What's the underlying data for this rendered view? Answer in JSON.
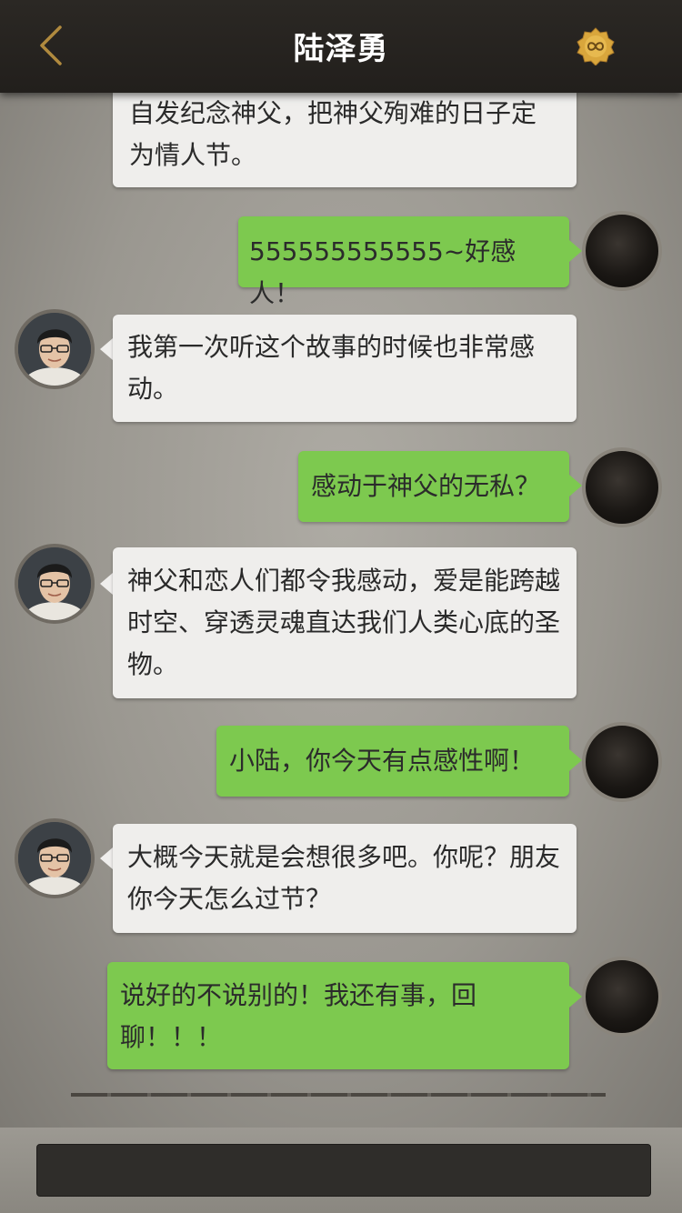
{
  "header": {
    "title": "陆泽勇",
    "back_icon": "chevron-left-icon",
    "badge_icon": "infinity-badge-icon",
    "accent": "#c89a3a"
  },
  "messages": [
    {
      "sender": "other",
      "text": "自发纪念神父，把神父殉难的日子定为情人节。"
    },
    {
      "sender": "self",
      "text": "555555555555~好感人！"
    },
    {
      "sender": "other",
      "text": "我第一次听这个故事的时候也非常感动。"
    },
    {
      "sender": "self",
      "text": "感动于神父的无私？"
    },
    {
      "sender": "other",
      "text": "神父和恋人们都令我感动，爱是能跨越时空、穿透灵魂直达我们人类心底的圣物。"
    },
    {
      "sender": "self",
      "text": "小陆，你今天有点感性啊！"
    },
    {
      "sender": "other",
      "text": "大概今天就是会想很多吧。你呢？朋友你今天怎么过节？"
    },
    {
      "sender": "self",
      "text": "说好的不说别的！我还有事，回聊！！！"
    }
  ],
  "input": {
    "placeholder": ""
  },
  "colors": {
    "self_bubble": "#7dc94f",
    "other_bubble": "#efeeec",
    "topbar": "#252220"
  }
}
